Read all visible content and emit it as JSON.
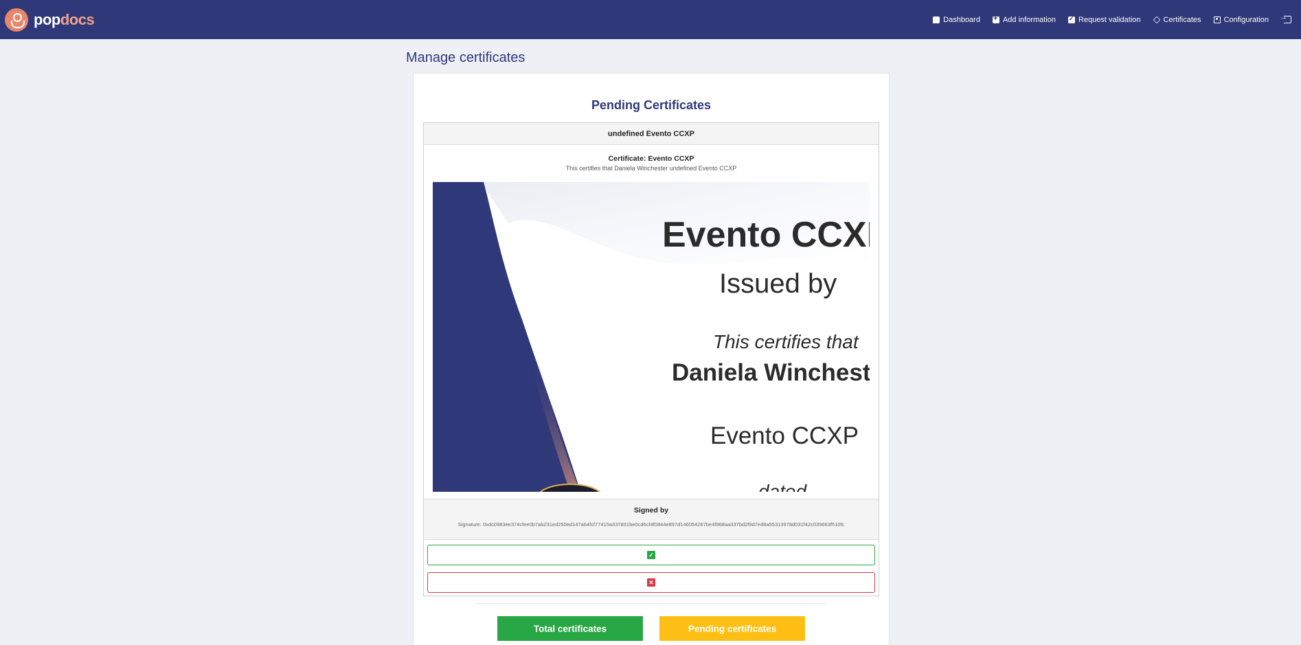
{
  "brand": {
    "name_part1": "pop",
    "name_part2": "docs"
  },
  "nav": {
    "items": [
      {
        "label": "Dashboard",
        "icon": "chat-icon"
      },
      {
        "label": "Add information",
        "icon": "plus-square-icon"
      },
      {
        "label": "Request validation",
        "icon": "check-square-icon"
      },
      {
        "label": "Certificates",
        "icon": "layers-icon"
      },
      {
        "label": "Configuration",
        "icon": "user-square-icon"
      }
    ],
    "logout_icon": "logout-icon"
  },
  "page": {
    "title": "Manage certificates"
  },
  "pending": {
    "section_title": "Pending Certificates",
    "certificate": {
      "header": "undefined Evento CCXP",
      "title": "Certificate: Evento CCXP",
      "description": "This certifies that Daniela Winchester undefined Evento CCXP",
      "preview": {
        "name": "Evento CCXP",
        "issued_by": "Issued by",
        "certifies": "This certifies that",
        "recipient": "Daniela Winchester",
        "event": "Evento CCXP",
        "dated": "dated"
      },
      "signed_by_label": "Signed by",
      "signature": "Signature: 0xdc0983ee374cfee0b7ab231ed250ed147a64fcf77415a337831be0cd6cf4f0844e897d146054267be4f968aa337bd2f9d7ed8a55313978d031f42c039663f510fc",
      "approve_icon": "check-square-icon",
      "reject_icon": "x-square-icon"
    }
  },
  "stats": {
    "total_label": "Total certificates",
    "pending_label": "Pending certificates"
  },
  "colors": {
    "navbar": "#2f3879",
    "accent_orange": "#e8866b",
    "approve": "#28a745",
    "reject": "#dc3545",
    "pending": "#fdbf13",
    "background": "#eff0f5"
  }
}
